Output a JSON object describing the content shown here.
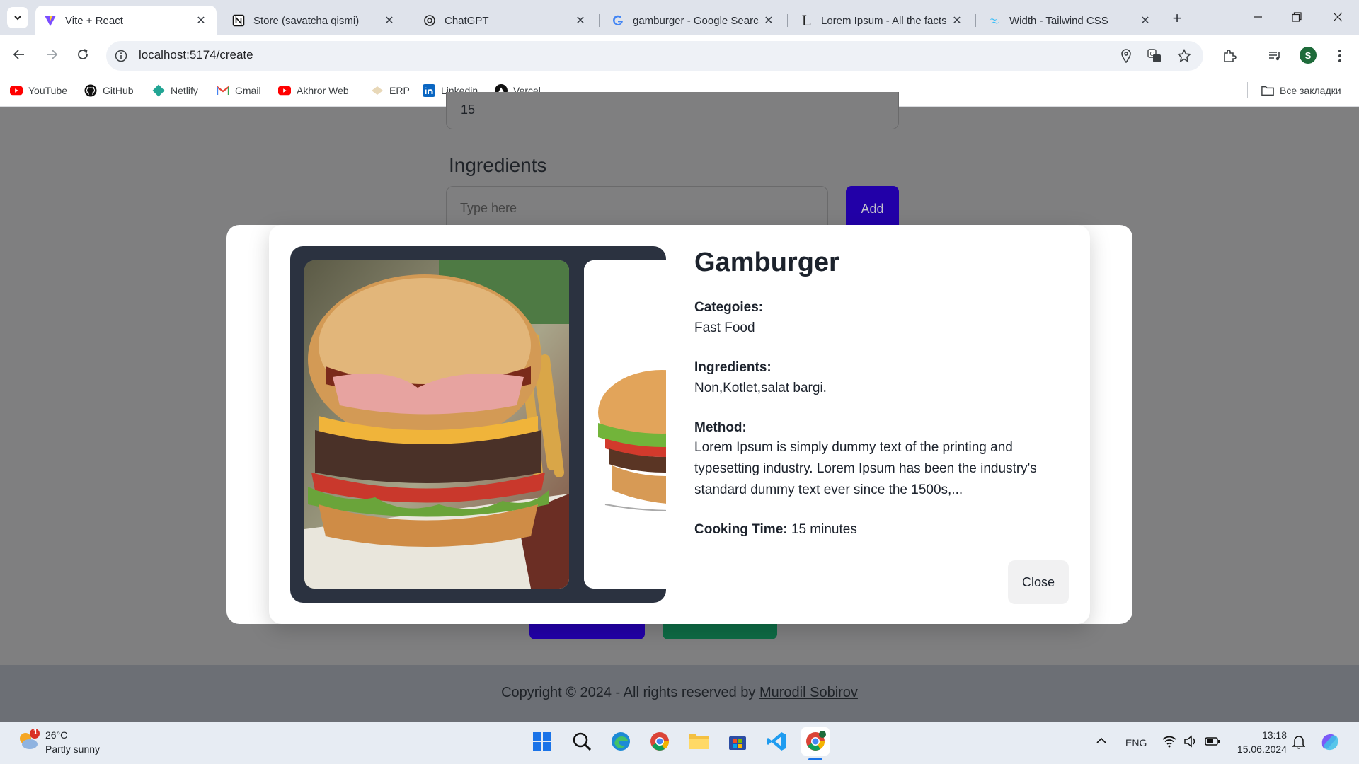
{
  "browser": {
    "tabs": [
      {
        "title": "Vite + React",
        "icon": "vite-icon",
        "active": true
      },
      {
        "title": "Store (savatcha qismi)",
        "icon": "notion-icon",
        "active": false
      },
      {
        "title": "ChatGPT",
        "icon": "chatgpt-icon",
        "active": false
      },
      {
        "title": "gamburger - Google Searc",
        "icon": "google-icon",
        "active": false
      },
      {
        "title": "Lorem Ipsum - All the facts",
        "icon": "lipsum-icon",
        "active": false
      },
      {
        "title": "Width - Tailwind CSS",
        "icon": "tailwind-icon",
        "active": false
      }
    ],
    "url": "localhost:5174/create",
    "profile_initial": "S",
    "bookmarks": [
      {
        "label": "YouTube",
        "icon": "youtube-icon"
      },
      {
        "label": "GitHub",
        "icon": "github-icon"
      },
      {
        "label": "Netlify",
        "icon": "netlify-icon"
      },
      {
        "label": "Gmail",
        "icon": "gmail-icon"
      },
      {
        "label": "Akhror Web",
        "icon": "youtube-icon"
      },
      {
        "label": "ERP",
        "icon": "erp-icon"
      },
      {
        "label": "Linkedin",
        "icon": "linkedin-icon"
      },
      {
        "label": "Vercel",
        "icon": "vercel-icon"
      }
    ],
    "all_bookmarks": "Все закладки"
  },
  "page": {
    "cooking_value": "15",
    "ingredients_label": "Ingredients",
    "ingredients_placeholder": "Type here",
    "add_label": "Add",
    "footer_prefix": "Copyright © 2024 - All rights reserved by ",
    "footer_author": "Murodil Sobirov"
  },
  "modal": {
    "title": "Gamburger",
    "categories_label": "Categoies:",
    "categories_value": "Fast Food",
    "ingredients_label": "Ingredients:",
    "ingredients_value": "Non,Kotlet,salat bargi.",
    "method_label": "Method:",
    "method_value": "Lorem Ipsum is simply dummy text of the printing and typesetting industry. Lorem Ipsum has been the industry's standard dummy text ever since the 1500s,...",
    "cooking_label": "Cooking Time:",
    "cooking_value": "15 minutes",
    "close_label": "Close"
  },
  "taskbar": {
    "weather_temp": "26°C",
    "weather_desc": "Partly sunny",
    "weather_badge": "1",
    "language": "ENG",
    "time": "13:18",
    "date": "15.06.2024"
  },
  "colors": {
    "add_button": "#2200a8",
    "modal_carousel_bg": "#2b3240",
    "page_overlay": "#7f7f80",
    "green_button": "#0e6b45"
  }
}
